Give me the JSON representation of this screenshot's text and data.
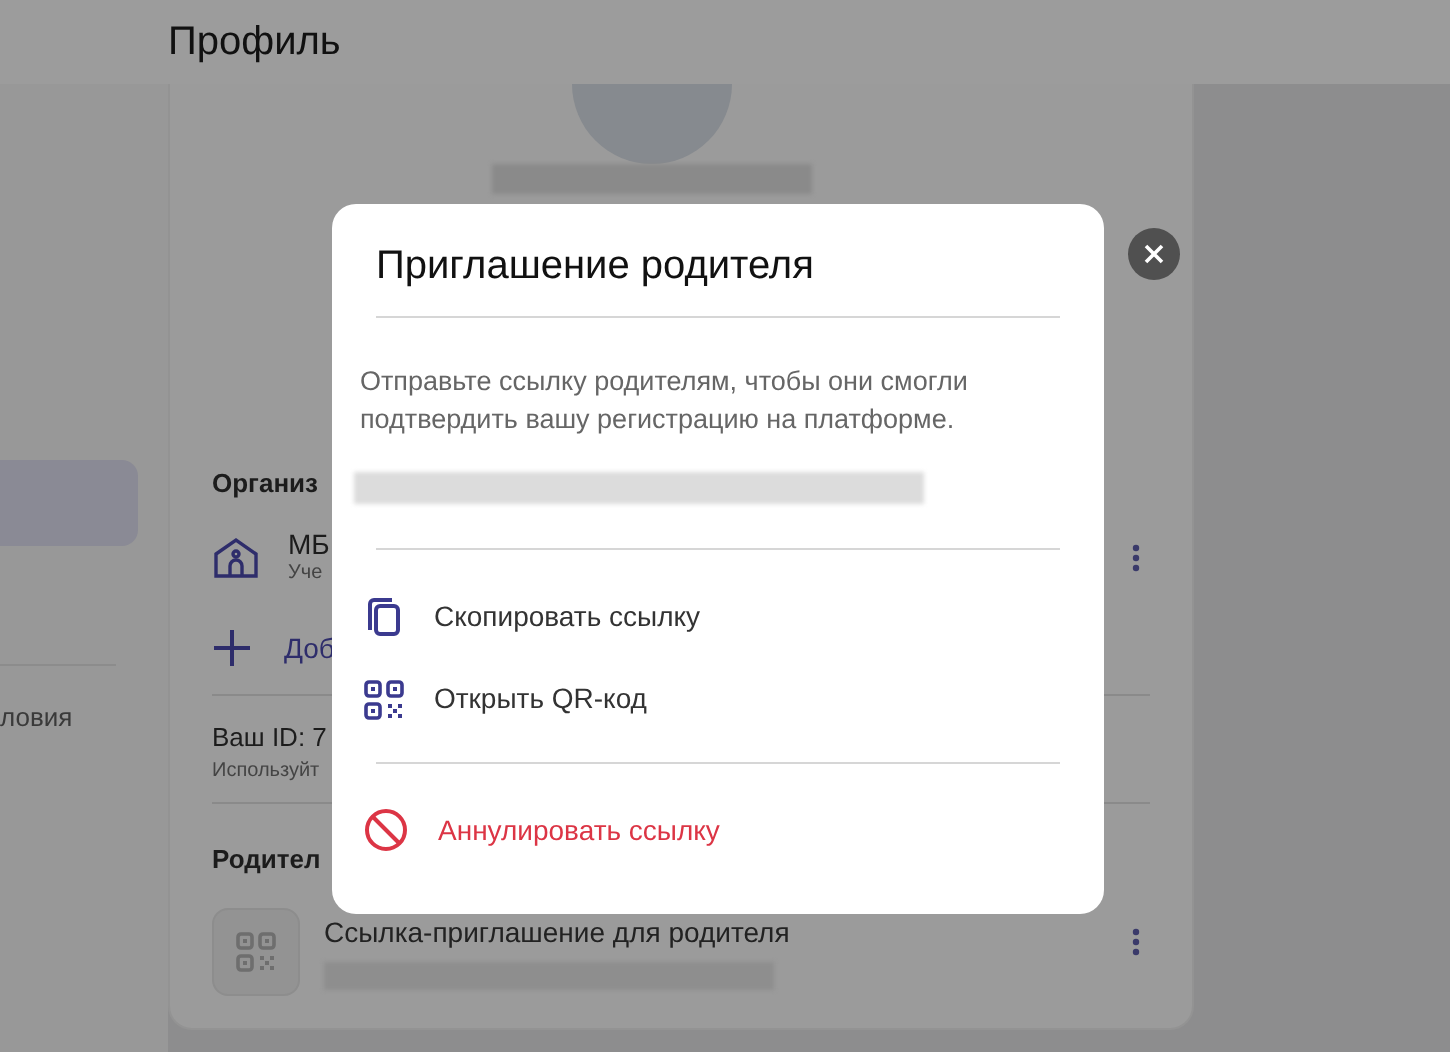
{
  "header": {
    "title": "Профиль"
  },
  "sidebar": {
    "items": [
      {
        "label": "ловия",
        "selected": false
      }
    ]
  },
  "profile": {
    "organization_heading": "Организ",
    "organization": {
      "name": "МБ",
      "subtitle": "Уче"
    },
    "add_label": "Доб",
    "id_label": "Ваш ID: 7",
    "id_hint": "Используйт",
    "parents_heading": "Родител",
    "parent_link": {
      "title": "Ссылка-приглашение для родителя"
    }
  },
  "dialog": {
    "title": "Приглашение родителя",
    "description": "Отправьте ссылку родителям, чтобы они смогли подтвердить вашу регистрацию на платформе.",
    "actions": [
      {
        "kind": "copy",
        "label": "Скопировать ссылку"
      },
      {
        "kind": "qr",
        "label": "Открыть QR-код"
      },
      {
        "kind": "revoke",
        "label": "Аннулировать ссылку"
      }
    ]
  }
}
